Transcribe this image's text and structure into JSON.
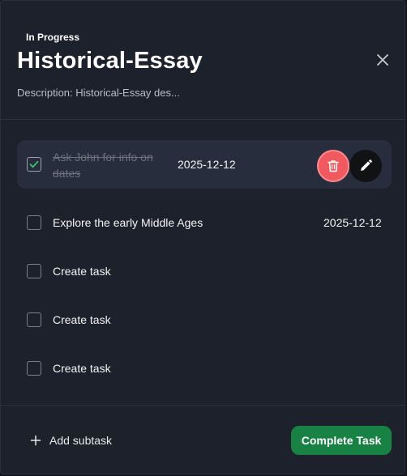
{
  "task": {
    "status": "In Progress",
    "title": "Historical-Essay",
    "description": "Description: Historical-Essay des..."
  },
  "subtasks": [
    {
      "label": "Ask John for info on dates",
      "date": "2025-12-12",
      "checked": true
    },
    {
      "label": "Explore the early Middle Ages",
      "date": "2025-12-12",
      "checked": false
    },
    {
      "label": "Create task",
      "date": "",
      "checked": false
    },
    {
      "label": "Create task",
      "date": "",
      "checked": false
    },
    {
      "label": "Create task",
      "date": "",
      "checked": false
    }
  ],
  "footer": {
    "add_subtask_label": "Add subtask",
    "complete_label": "Complete Task"
  },
  "icons": {
    "close": "close-icon",
    "check": "check-icon",
    "delete": "trash-icon",
    "edit": "pencil-icon",
    "add": "plus-icon"
  },
  "colors": {
    "background": "#1d212c",
    "highlight_row": "#282d3d",
    "check_green": "#3ac46b",
    "delete_red": "#f05a5f",
    "complete_green": "#188244"
  }
}
